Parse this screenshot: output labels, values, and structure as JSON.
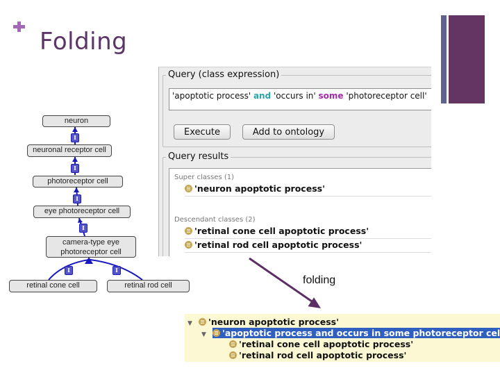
{
  "slide": {
    "title": "Folding",
    "bullet_icon": "plus-icon",
    "colors": {
      "title": "#5b3566",
      "accent_bar": "#643563",
      "accent_bar_thin": "#5f6191",
      "plus": "#a568b8"
    }
  },
  "query_panel": {
    "query_group_label": "Query (class expression)",
    "query_expression": {
      "part1": "'apoptotic process' ",
      "kw1": "and",
      "part2": " 'occurs in' ",
      "kw2": "some",
      "part3": " 'photoreceptor cell'"
    },
    "execute_label": "Execute",
    "add_to_ontology_label": "Add to ontology",
    "results_group_label": "Query results",
    "super_classes_header": "Super classes (1)",
    "super_classes": [
      "'neuron apoptotic process'"
    ],
    "descendant_classes_header": "Descendant classes (2)",
    "descendant_classes": [
      "'retinal cone cell apoptotic process'",
      "'retinal rod cell apoptotic process'"
    ]
  },
  "diagram": {
    "badge_label": "I",
    "nodes": {
      "neuron": "neuron",
      "neuronal_receptor": "neuronal receptor cell",
      "photoreceptor": "photoreceptor cell",
      "eye_photoreceptor": "eye photoreceptor cell",
      "camera_type_1": "camera-type eye",
      "camera_type_2": "photoreceptor cell",
      "retinal_cone": "retinal cone cell",
      "retinal_rod": "retinal rod cell"
    }
  },
  "folding_label": "folding",
  "folded_tree": {
    "rows": [
      {
        "label": "'neuron apoptotic process'",
        "expanded": true,
        "selected": false
      },
      {
        "label": "'apoptotic process and occurs in some photoreceptor cell'",
        "expanded": true,
        "selected": true
      },
      {
        "label": "'retinal cone cell apoptotic process'",
        "expanded": false,
        "selected": false
      },
      {
        "label": "'retinal rod cell apoptotic process'",
        "expanded": false,
        "selected": false
      }
    ],
    "expand_glyph": "▼"
  }
}
